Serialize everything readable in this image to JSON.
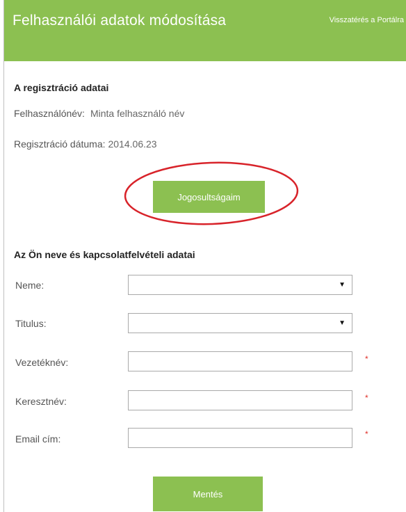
{
  "header": {
    "title": "Felhasználói adatok módosítása",
    "back_link": "Visszatérés a Portálra"
  },
  "registration": {
    "section_title": "A regisztráció adatai",
    "username_label": "Felhasználónév:",
    "username_value": "Minta felhasználó név",
    "date_label": "Regisztráció dátuma:",
    "date_value": "2014.06.23",
    "permissions_button": "Jogosultságaim"
  },
  "contact": {
    "section_title": "Az Ön neve és kapcsolatfelvételi adatai",
    "fields": [
      {
        "label": "Neme:",
        "type": "select",
        "value": "",
        "required": false
      },
      {
        "label": "Titulus:",
        "type": "select",
        "value": "",
        "required": false
      },
      {
        "label": "Vezetéknév:",
        "type": "text",
        "value": "",
        "required": true
      },
      {
        "label": "Keresztnév:",
        "type": "text",
        "value": "",
        "required": true
      },
      {
        "label": "Email cím:",
        "type": "text",
        "value": "",
        "required": true
      }
    ],
    "required_marker": "*",
    "save_button": "Mentés"
  },
  "colors": {
    "accent": "#8cc051",
    "highlight": "#d8232a",
    "required": "#e0322b"
  }
}
